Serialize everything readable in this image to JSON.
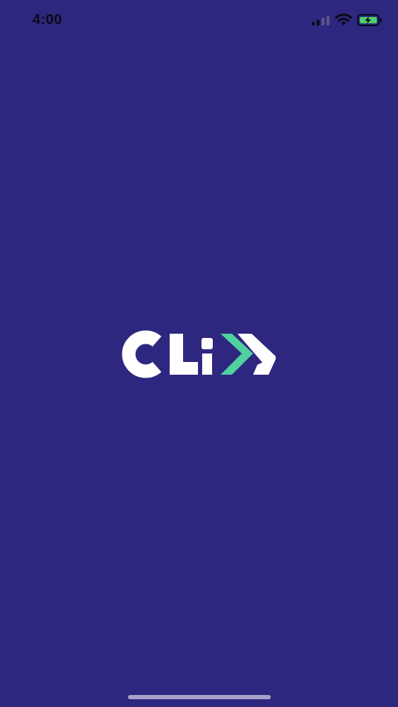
{
  "status_bar": {
    "time": "4:00",
    "signal_icon": "cellular-signal-icon",
    "wifi_icon": "wifi-icon",
    "battery_icon": "battery-charging-icon"
  },
  "splash": {
    "logo_text": "CLiX",
    "background_color": "#2e2780",
    "logo_primary_color": "#ffffff",
    "logo_accent_color": "#4fd1a0"
  }
}
